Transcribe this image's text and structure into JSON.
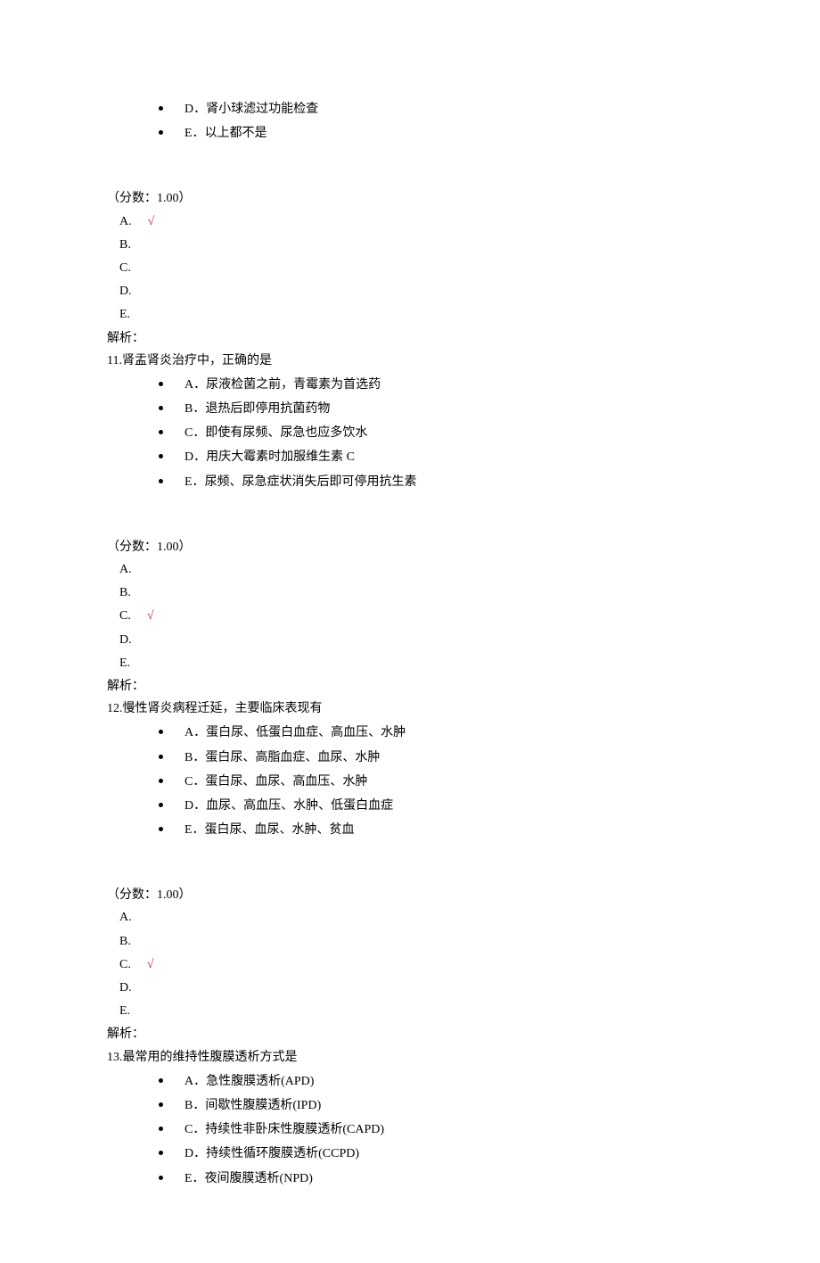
{
  "checkMark": "√",
  "q10_tail": {
    "options": [
      {
        "label": "D．",
        "text": "肾小球滤过功能检查"
      },
      {
        "label": "E．",
        "text": "以上都不是"
      }
    ],
    "score": "（分数：1.00）",
    "answers": [
      "A.",
      "B.",
      "C.",
      "D.",
      "E."
    ],
    "correctIndex": 0,
    "analysisLabel": "解析："
  },
  "q11": {
    "stem": "11.肾盂肾炎治疗中，正确的是",
    "options": [
      {
        "label": "A．",
        "text": "尿液检菌之前，青霉素为首选药"
      },
      {
        "label": "B．",
        "text": "退热后即停用抗菌药物"
      },
      {
        "label": "C．",
        "text": "即使有尿频、尿急也应多饮水"
      },
      {
        "label": "D．",
        "text": "用庆大霉素时加服维生素 C"
      },
      {
        "label": "E．",
        "text": "尿频、尿急症状消失后即可停用抗生素"
      }
    ],
    "score": "（分数：1.00）",
    "answers": [
      "A.",
      "B.",
      "C.",
      "D.",
      "E."
    ],
    "correctIndex": 2,
    "analysisLabel": "解析："
  },
  "q12": {
    "stem": "12.慢性肾炎病程迁延，主要临床表现有",
    "options": [
      {
        "label": "A．",
        "text": "蛋白尿、低蛋白血症、高血压、水肿"
      },
      {
        "label": "B．",
        "text": "蛋白尿、高脂血症、血尿、水肿"
      },
      {
        "label": "C．",
        "text": "蛋白尿、血尿、高血压、水肿"
      },
      {
        "label": "D．",
        "text": "血尿、高血压、水肿、低蛋白血症"
      },
      {
        "label": "E．",
        "text": "蛋白尿、血尿、水肿、贫血"
      }
    ],
    "score": "（分数：1.00）",
    "answers": [
      "A.",
      "B.",
      "C.",
      "D.",
      "E."
    ],
    "correctIndex": 2,
    "analysisLabel": "解析："
  },
  "q13": {
    "stem": "13.最常用的维持性腹膜透析方式是",
    "options": [
      {
        "label": "A．",
        "text": "急性腹膜透析(APD)"
      },
      {
        "label": "B．",
        "text": "间歇性腹膜透析(IPD)"
      },
      {
        "label": "C．",
        "text": "持续性非卧床性腹膜透析(CAPD)"
      },
      {
        "label": "D．",
        "text": "持续性循环腹膜透析(CCPD)"
      },
      {
        "label": "E．",
        "text": "夜间腹膜透析(NPD)"
      }
    ]
  }
}
